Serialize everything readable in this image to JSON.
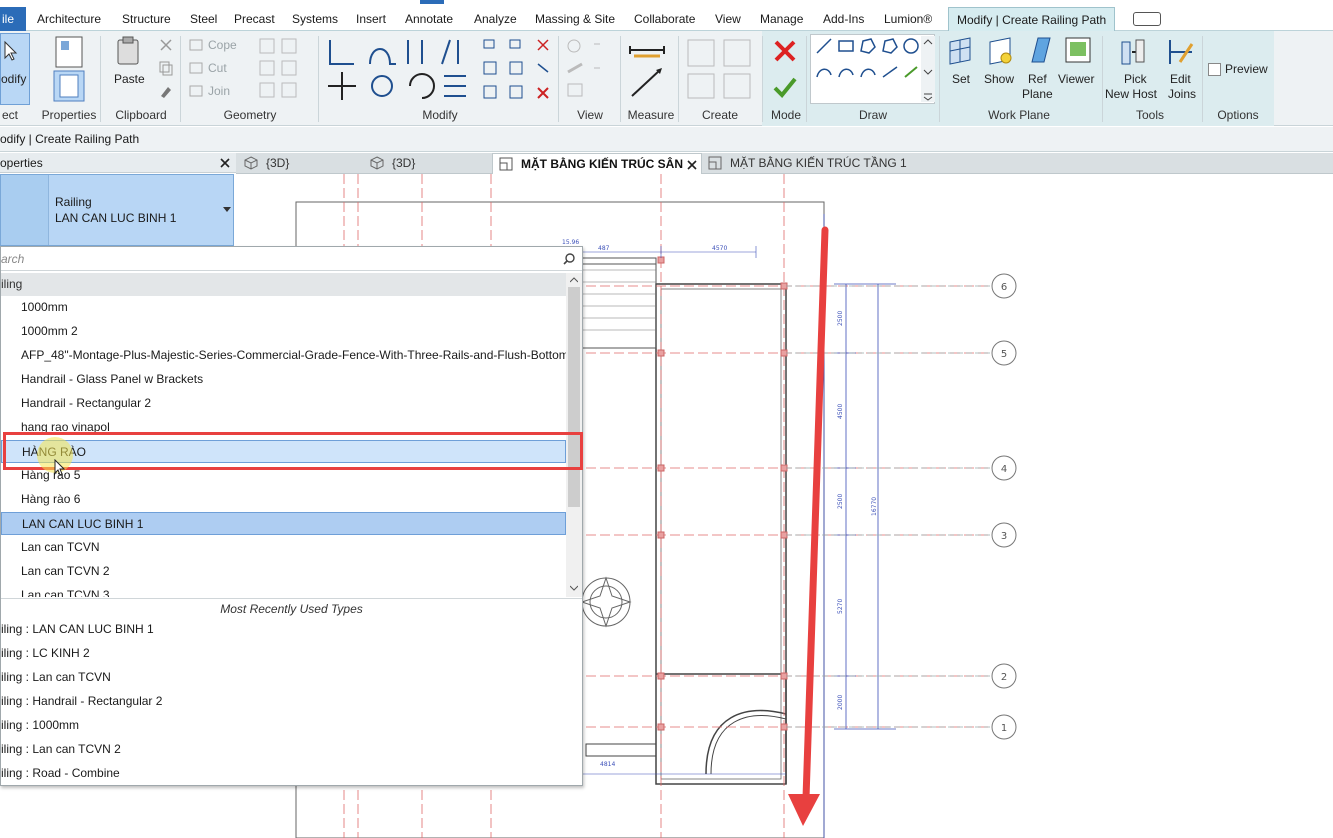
{
  "ribbon": {
    "tabs": [
      "ile",
      "Architecture",
      "Structure",
      "Steel",
      "Precast",
      "Systems",
      "Insert",
      "Annotate",
      "Analyze",
      "Massing & Site",
      "Collaborate",
      "View",
      "Manage",
      "Add-Ins",
      "Lumion®",
      "Modify | Create Railing Path"
    ],
    "groups": {
      "select": "ect",
      "properties": "Properties",
      "clipboard": "Clipboard",
      "geometry": "Geometry",
      "modify": "Modify",
      "view": "View",
      "measure": "Measure",
      "create": "Create",
      "mode": "Mode",
      "draw": "Draw",
      "work_plane": "Work Plane",
      "tools": "Tools",
      "options": "Options"
    },
    "buttons": {
      "modify": "odify",
      "properties": "Properties",
      "paste": "Paste",
      "cope": "Cope",
      "cut": "Cut",
      "join": "Join",
      "set": "Set",
      "show": "Show",
      "ref_plane_1": "Ref",
      "ref_plane_2": "Plane",
      "viewer": "Viewer",
      "pick_new_host_1": "Pick",
      "pick_new_host_2": "New Host",
      "edit_joins_1": "Edit",
      "edit_joins_2": "Joins",
      "preview": "Preview"
    }
  },
  "options_bar": {
    "text": "odify | Create Railing Path"
  },
  "properties": {
    "header": "operties",
    "family": "Railing",
    "type": "LAN CAN LUC BINH 1"
  },
  "view_tabs": [
    "{3D}",
    "{3D}",
    "MẶT BẰNG KIẾN TRÚC SÂN",
    "MẶT BẰNG KIẾN TRÚC TẦNG 1"
  ],
  "dropdown": {
    "search_placeholder": "arch",
    "category": "iling",
    "items": [
      "1000mm",
      "1000mm 2",
      "AFP_48\"-Montage-Plus-Majestic-Series-Commercial-Grade-Fence-With-Three-Rails-and-Flush-Bottom",
      "Handrail - Glass Panel w Brackets",
      "Handrail - Rectangular 2",
      "hang rao vinapol",
      "HÀNG RÀO",
      "Hàng rào 5",
      "Hàng rào 6",
      "LAN CAN LUC BINH 1",
      "Lan can TCVN",
      "Lan can TCVN 2",
      "Lan can TCVN 3"
    ],
    "hovered": "HÀNG RÀO",
    "selected": "LAN CAN LUC BINH 1",
    "mru_header": "Most Recently Used Types",
    "mru": [
      "iling : LAN CAN LUC BINH 1",
      "iling : LC KINH 2",
      "iling : Lan can TCVN",
      "iling : Handrail - Rectangular 2",
      "iling : 1000mm",
      "iling : Lan can TCVN 2",
      "iling : Road - Combine"
    ]
  },
  "drawing": {
    "grid_labels": [
      "6",
      "5",
      "4",
      "3",
      "2",
      "1"
    ],
    "dims": [
      "2500",
      "4500",
      "2500",
      "5270",
      "2000",
      "16770"
    ],
    "top_dims": [
      "15.96",
      "487",
      "4570"
    ],
    "bottom_dim": "4814"
  },
  "colors": {
    "file_tab": "#2b6cb8",
    "selection": "#aecdf2",
    "highlight_box": "#e8403f",
    "arrow": "#e8403f"
  }
}
